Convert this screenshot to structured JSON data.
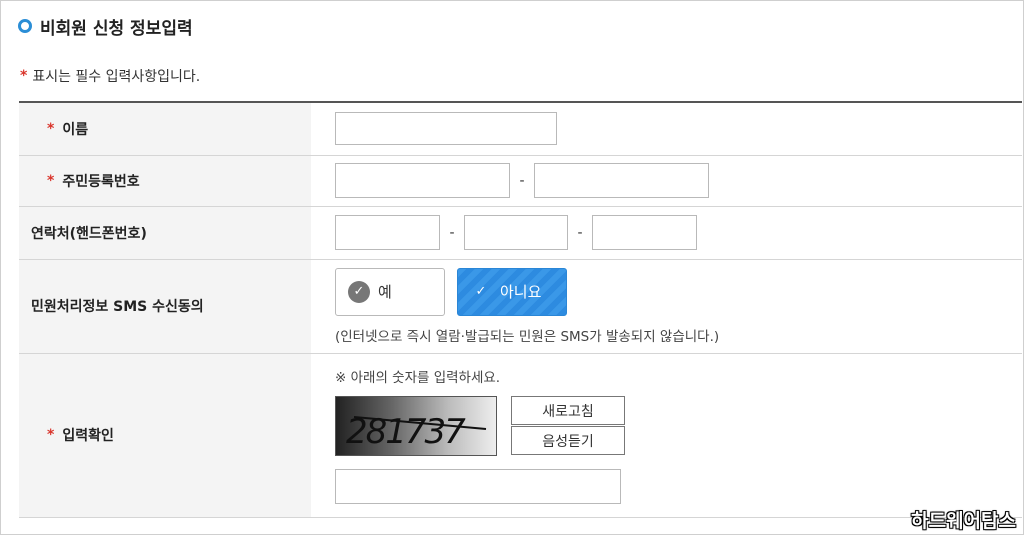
{
  "section_title": "비회원 신청 정보입력",
  "required_note": {
    "star": "*",
    "text": "표시는 필수 입력사항입니다."
  },
  "fields": {
    "name": {
      "label": "이름",
      "required": true,
      "value": ""
    },
    "resident_number": {
      "label": "주민등록번호",
      "required": true,
      "value_front": "",
      "value_back": "",
      "separator": "-"
    },
    "phone": {
      "label": "연락처(핸드폰번호)",
      "required": false,
      "part1": "",
      "part2": "",
      "part3": "",
      "separator": "-"
    },
    "sms_consent": {
      "label": "민원처리정보 SMS 수신동의",
      "options": [
        "예",
        "아니요"
      ],
      "selected": "아니요",
      "note": "(인터넷으로 즉시 열람·발급되는 민원은 SMS가 발송되지 않습니다.)"
    },
    "captcha": {
      "label": "입력확인",
      "required": true,
      "guide": "※ 아래의 숫자를 입력하세요.",
      "code": "281737",
      "refresh_label": "새로고침",
      "audio_label": "음성듣기",
      "value": ""
    }
  },
  "watermark": "하드웨어탐스",
  "colors": {
    "accent_blue": "#2b8ed6",
    "required_red": "#d9342b",
    "selected_option": "#3a98e8"
  },
  "icons": {
    "check": "check-icon",
    "bullet": "ring-bullet-icon"
  }
}
